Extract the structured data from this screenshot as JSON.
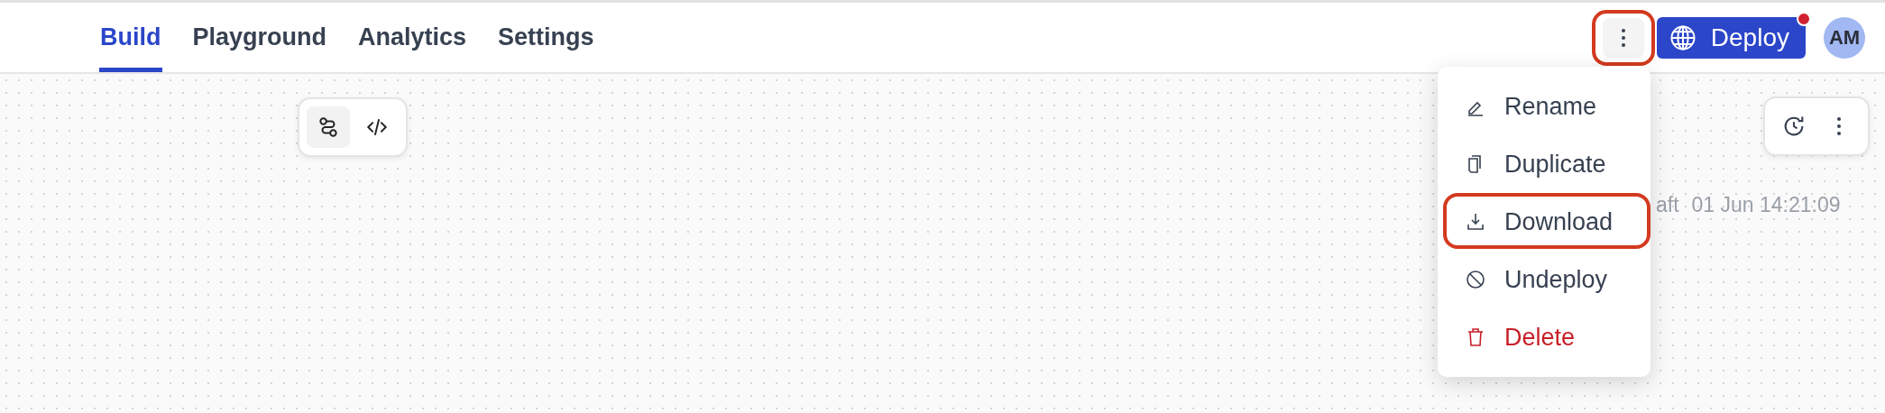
{
  "tabs": [
    {
      "label": "Build",
      "selected": true
    },
    {
      "label": "Playground",
      "selected": false
    },
    {
      "label": "Analytics",
      "selected": false
    },
    {
      "label": "Settings",
      "selected": false
    }
  ],
  "header_actions": {
    "more_button": {
      "highlighted": true
    },
    "deploy_button": {
      "label": "Deploy",
      "notification": true
    },
    "avatar": {
      "initials": "AM"
    }
  },
  "canvas_toolbar": {
    "items": [
      {
        "kind": "flow",
        "selected": true
      },
      {
        "kind": "code",
        "selected": false
      }
    ]
  },
  "version_status": {
    "state": "aft",
    "timestamp": "01 Jun 14:21:09"
  },
  "menu": {
    "items": [
      {
        "kind": "rename",
        "label": "Rename",
        "danger": false,
        "highlighted": false
      },
      {
        "kind": "duplicate",
        "label": "Duplicate",
        "danger": false,
        "highlighted": false
      },
      {
        "kind": "download",
        "label": "Download",
        "danger": false,
        "highlighted": true
      },
      {
        "kind": "undeploy",
        "label": "Undeploy",
        "danger": false,
        "highlighted": false
      },
      {
        "kind": "delete",
        "label": "Delete",
        "danger": true,
        "highlighted": false
      }
    ]
  }
}
